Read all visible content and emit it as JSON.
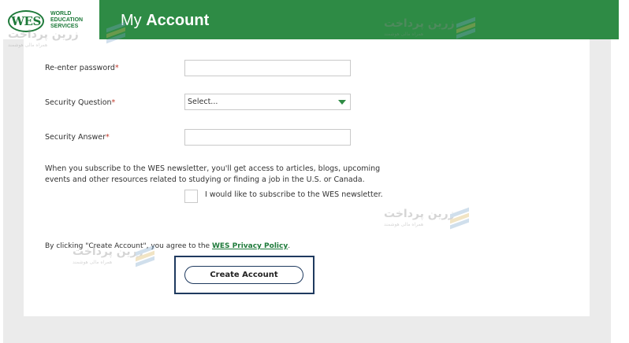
{
  "header": {
    "logo": {
      "mark": "WES",
      "lines": [
        "WORLD",
        "EDUCATION",
        "SERVICES"
      ]
    },
    "title_prefix": "My",
    "title_bold": "Account",
    "background_color": "#2e8b45"
  },
  "form": {
    "reenter_password": {
      "label": "Re-enter password",
      "required_mark": "*",
      "value": ""
    },
    "security_question": {
      "label": "Security Question",
      "required_mark": "*",
      "selected": "Select...",
      "icon": "chevron-down-icon"
    },
    "security_answer": {
      "label": "Security Answer",
      "required_mark": "*",
      "value": ""
    },
    "newsletter": {
      "description": "When you subscribe to the WES newsletter, you'll get access to articles, blogs, upcoming events and other resources related to studying or finding a job in the U.S. or Canada.",
      "checkbox_label": "I would like to subscribe to the WES newsletter.",
      "checked": false
    },
    "agreement": {
      "before": "By clicking \"Create Account\", you agree to the",
      "link": "WES Privacy Policy",
      "after": "."
    },
    "submit_label": "Create Account"
  },
  "watermarks": [
    {
      "title": "زرین پرداخت",
      "subtitle": "همراه مالی هوشمند"
    },
    {
      "title": "زرین پرداخت",
      "subtitle": "همراه مالی هوشمند"
    },
    {
      "title": "زرین پرداخت",
      "subtitle": "همراه مالی هوشمند"
    },
    {
      "title": "زرین پرداخت",
      "subtitle": "همراه مالی هوشمند"
    }
  ],
  "colors": {
    "brand_green": "#2e8b45",
    "link_green": "#1e7a3a",
    "focus_navy": "#1f3a5f",
    "required_red": "#c0392b"
  }
}
